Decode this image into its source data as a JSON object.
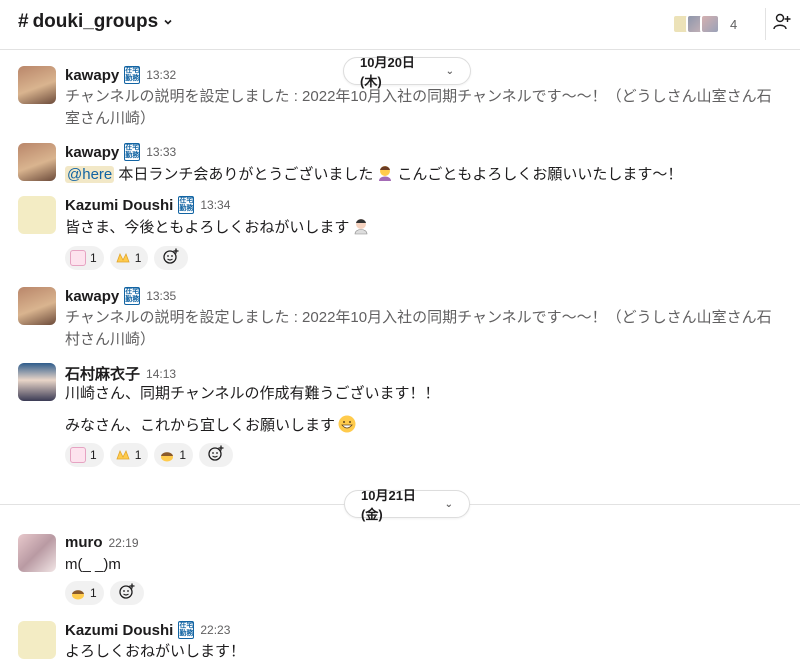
{
  "header": {
    "channel_hash": "#",
    "channel_name": "douki_groups",
    "member_count": "4",
    "colors": {
      "avatar_a": "#e9dcae",
      "avatar_b": "#9aa2b8",
      "avatar_c": "#c89aa0"
    }
  },
  "dates": [
    {
      "label": "10月20日 (木)"
    },
    {
      "label": "10月21日 (金)"
    }
  ],
  "badge": {
    "top": "在宅",
    "bottom": "勤務"
  },
  "messages": [
    {
      "user": "kawapy",
      "time": "13:32",
      "text": "チャンネルの説明を設定しました : 2022年10月入社の同期チャンネルです〜〜！（どうしさん山室さん石室さん川崎）"
    },
    {
      "user": "kawapy",
      "time": "13:33",
      "mention": "@here",
      "text": " 本日ランチ会ありがとうございました",
      "text2": "こんごともよろしくお願いいたします〜！"
    },
    {
      "user": "Kazumi Doushi",
      "time": "13:34",
      "text": "皆さま、今後ともよろしくおねがいします",
      "reactions": [
        {
          "count": "1"
        },
        {
          "count": "1"
        }
      ]
    },
    {
      "user": "kawapy",
      "time": "13:35",
      "text": "チャンネルの説明を設定しました : 2022年10月入社の同期チャンネルです〜〜！（どうしさん山室さん石村さん川崎）"
    },
    {
      "user": "石村麻衣子",
      "time": "14:13",
      "text": "川崎さん、同期チャンネルの作成有難うございます！！",
      "text2": "みなさん、これから宜しくお願いします",
      "reactions": [
        {
          "count": "1"
        },
        {
          "count": "1"
        },
        {
          "count": "1"
        }
      ]
    },
    {
      "user": "muro",
      "time": "22:19",
      "text": "m(_ _)m",
      "reactions": [
        {
          "count": "1"
        }
      ]
    },
    {
      "user": "Kazumi Doushi",
      "time": "22:23",
      "text": "よろしくおねがいします！"
    }
  ],
  "icons": {
    "emoji_bow": "person-bowing-emoji",
    "emoji_grin": "grinning-face-emoji",
    "reaction_yoroshiku": "yoroshiku-onegaishimasu-custom-emoji",
    "reaction_hands": "raised-hands-emoji",
    "reaction_bow": "bowing-emoji",
    "add_reaction": "add-reaction-icon"
  }
}
